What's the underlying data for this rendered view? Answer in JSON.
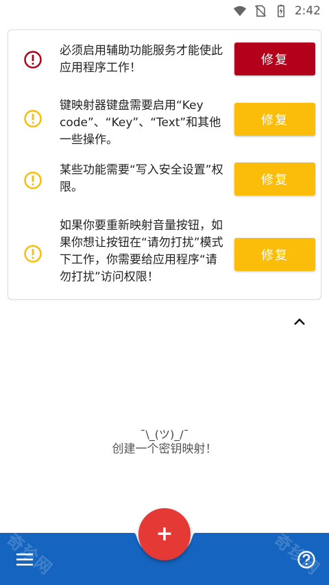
{
  "status_bar": {
    "time": "2:42"
  },
  "alerts": [
    {
      "level": "error",
      "icon": "error-icon",
      "text": "必须启用辅助功能服务才能使此应用程序工作！",
      "button": "修复"
    },
    {
      "level": "warning",
      "icon": "warning-icon",
      "text": "键映射器键盘需要启用“Key code”、“Key”、“Text”和其他一些操作。",
      "button": "修复"
    },
    {
      "level": "warning",
      "icon": "warning-icon",
      "text": "某些功能需要“写入安全设置”权限。",
      "button": "修复"
    },
    {
      "level": "warning",
      "icon": "warning-icon",
      "text": "如果你要重新映射音量按钮，如果你想让按钮在“请勿打扰”模式下工作，你需要给应用程序“请勿打扰”访问权限！",
      "button": "修复"
    }
  ],
  "empty_state": {
    "kaomoji": "¯\\_(ツ)_/¯",
    "text": "创建一个密钥映射！"
  },
  "fab": {
    "label": "+"
  },
  "watermark": "奇珍网",
  "colors": {
    "error": "#b3001b",
    "warning": "#fbbd0a",
    "primary": "#1565c0",
    "fab": "#e53935"
  }
}
